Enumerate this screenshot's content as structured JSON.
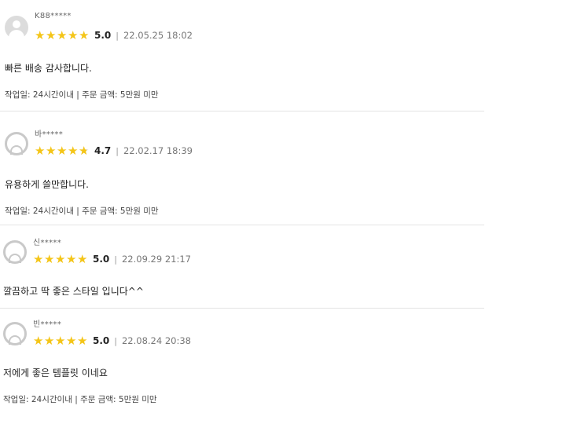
{
  "reviews": [
    {
      "name": "K88*****",
      "score": "5.0",
      "rating": 5.0,
      "separator": "|",
      "date": "22.05.25 18:02",
      "text": "빠른 배송 감사합니다.",
      "info": "작업일: 24시간이내 | 주문 금액: 5만원 미만",
      "avatar": "person-icon"
    },
    {
      "name": "바*****",
      "score": "4.7",
      "rating": 4.7,
      "separator": "|",
      "date": "22.02.17 18:39",
      "text": "유용하게 쓸만합니다.",
      "info": "작업일: 24시간이내 | 주문 금액: 5만원 미만",
      "avatar": "person-outline-icon"
    },
    {
      "name": "신*****",
      "score": "5.0",
      "rating": 5.0,
      "separator": "|",
      "date": "22.09.29 21:17",
      "text": "깔끔하고 딱 좋은 스타일 입니다^^",
      "avatar": "person-outline-icon"
    },
    {
      "name": "빈*****",
      "score": "5.0",
      "rating": 5.0,
      "separator": "|",
      "date": "22.08.24 20:38",
      "text": "저에게 좋은 템플릿 이네요",
      "info": "작업일: 24시간이내 | 주문 금액: 5만원 미만",
      "avatar": "person-outline-icon"
    }
  ],
  "colors": {
    "star": "#f4c518",
    "star_empty": "#dcdcdc",
    "divider": "#e4e4e4"
  }
}
